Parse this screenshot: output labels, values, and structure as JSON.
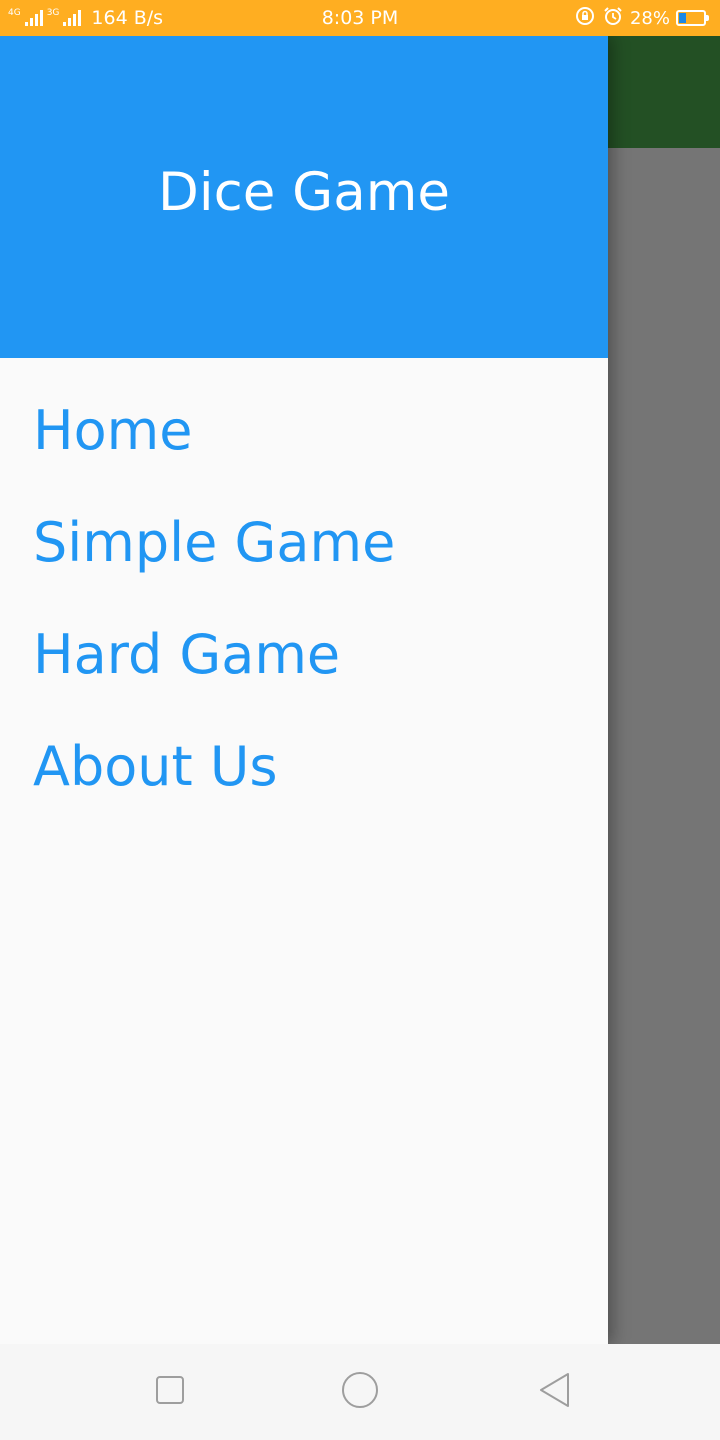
{
  "status_bar": {
    "network_type_1": "4G",
    "network_type_2": "3G",
    "data_speed": "164 B/s",
    "time": "8:03 PM",
    "battery_percent": "28%",
    "battery_level": 0.28,
    "bg_color": "#FFAE21"
  },
  "drawer": {
    "header_title": "Dice Game",
    "header_color": "#2196F3",
    "items": [
      {
        "label": "Home"
      },
      {
        "label": "Simple Game"
      },
      {
        "label": "Hard Game"
      },
      {
        "label": "About Us"
      }
    ]
  },
  "background_app": {
    "appbar_color": "#4CAF50"
  },
  "nav_bar": {
    "buttons": [
      "recents-icon",
      "home-icon",
      "back-icon"
    ]
  }
}
